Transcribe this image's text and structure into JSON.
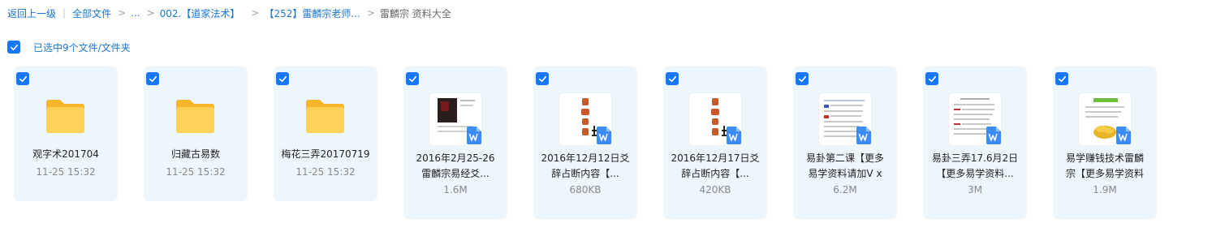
{
  "breadcrumb": {
    "back": "返回上一级",
    "root": "全部文件",
    "ellipsis": "...",
    "crumb1": "002.【道家法术】",
    "crumb2": "【252】雷麟宗老师...",
    "current": "雷麟宗 资料大全"
  },
  "selection": {
    "label": "已选中9个文件/文件夹"
  },
  "colors": {
    "accent": "#1677ff",
    "card_bg": "#eef6fd",
    "folder": "#ffc94a",
    "word": "#3d8cf5"
  },
  "items": [
    {
      "type": "folder",
      "icon": "folder-icon",
      "name_line1": "观字术201704",
      "name_line2": "",
      "meta": "11-25 15:32"
    },
    {
      "type": "folder",
      "icon": "folder-icon",
      "name_line1": "归藏古易数",
      "name_line2": "",
      "meta": "11-25 15:32"
    },
    {
      "type": "folder",
      "icon": "folder-icon",
      "name_line1": "梅花三弄20170719",
      "name_line2": "",
      "meta": "11-25 15:32"
    },
    {
      "type": "doc",
      "icon": "word-doc-icon",
      "name_line1": "2016年2月25-26",
      "name_line2": "雷麟宗易经爻...",
      "meta": "1.6M"
    },
    {
      "type": "doc",
      "icon": "word-doc-icon",
      "name_line1": "2016年12月12日爻",
      "name_line2": "辞占断内容【...",
      "meta": "680KB"
    },
    {
      "type": "doc",
      "icon": "word-doc-icon",
      "name_line1": "2016年12月17日爻",
      "name_line2": "辞占断内容【...",
      "meta": "420KB"
    },
    {
      "type": "doc",
      "icon": "word-doc-icon",
      "name_line1": "易卦第二课【更多",
      "name_line2": "易学资料请加V x",
      "meta": "6.2M"
    },
    {
      "type": "doc",
      "icon": "word-doc-icon",
      "name_line1": "易卦三弄17.6月2日",
      "name_line2": "【更多易学资料...",
      "meta": "3M"
    },
    {
      "type": "doc",
      "icon": "word-doc-icon",
      "name_line1": "易学赚钱技术雷麟",
      "name_line2": "宗【更多易学资料",
      "meta": "1.9M"
    }
  ]
}
